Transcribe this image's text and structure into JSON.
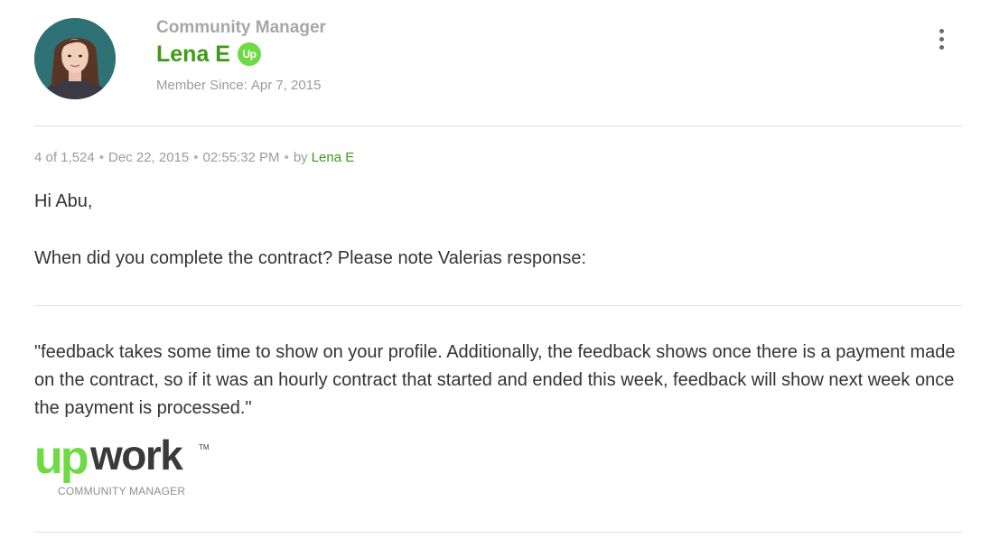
{
  "author": {
    "rank": "Community Manager",
    "name": "Lena E",
    "badge_text": "Up",
    "member_since_label": "Member Since:",
    "member_since_date": "Apr 7, 2015"
  },
  "meta": {
    "position": "4 of 1,524",
    "date": "Dec 22, 2015",
    "time": "02:55:32 PM",
    "by_label": "by",
    "author": "Lena E"
  },
  "body": {
    "greeting": "Hi Abu,",
    "question": "When did you complete the contract? Please note Valerias response:",
    "quote": " \"feedback takes some time to show on your profile. Additionally, the feedback shows once there is a payment made on the contract, so if it was an hourly contract that started and ended this week, feedback will show next week once the payment is processed.\""
  },
  "signature": {
    "logo_up": "up",
    "logo_work": "work",
    "logo_tm": "TM",
    "caption": "COMMUNITY MANAGER"
  },
  "colors": {
    "brand_green": "#3e9b16",
    "logo_green": "#6fda44",
    "muted_text": "#9b9b9b",
    "divider": "#e2e2e2"
  },
  "icons": {
    "options": "vertical-ellipsis-icon",
    "badge": "upwork-badge-icon"
  }
}
